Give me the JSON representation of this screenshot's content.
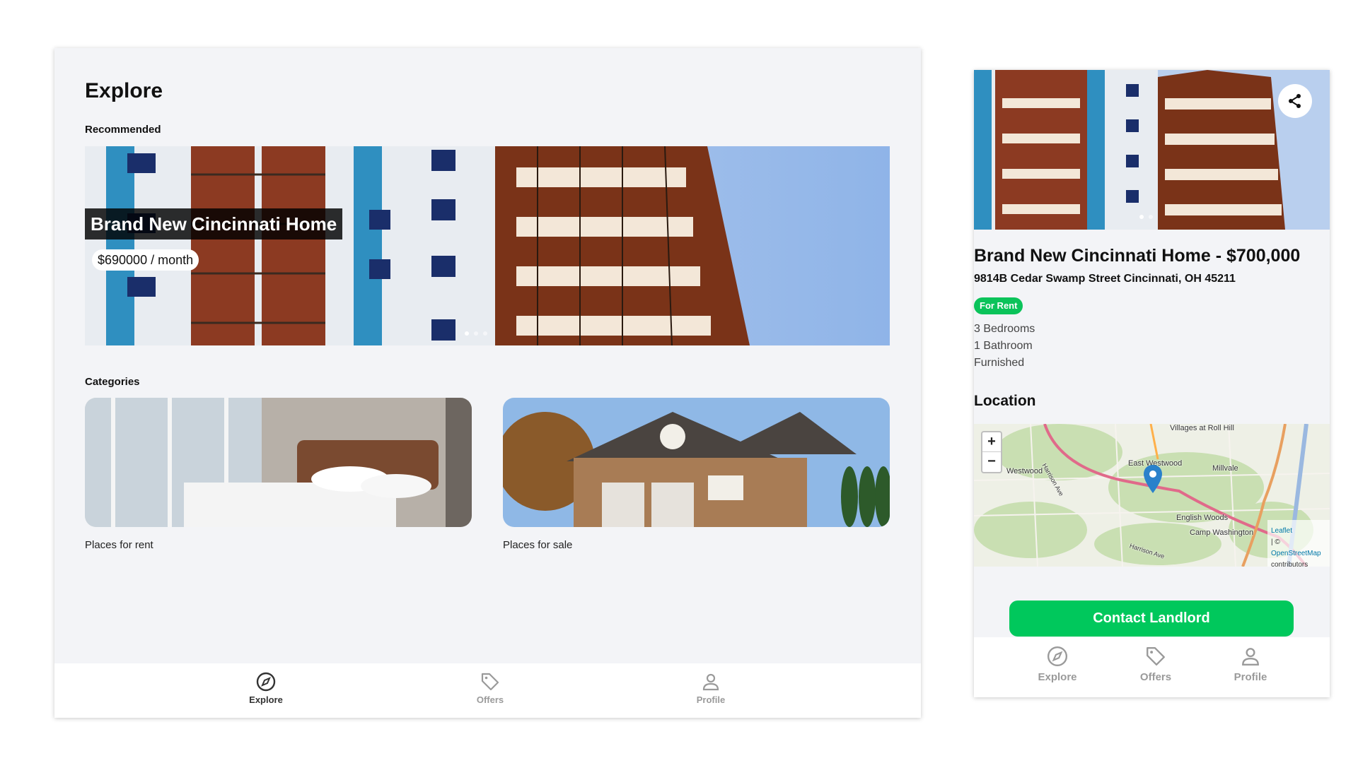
{
  "desktop": {
    "title": "Explore",
    "recommended_label": "Recommended",
    "featured": {
      "title": "Brand New Cincinnati Home",
      "price": "$690000 / month",
      "slide_count": 3,
      "active_slide": 1
    },
    "categories_label": "Categories",
    "categories": [
      {
        "label": "Places for rent"
      },
      {
        "label": "Places for sale"
      }
    ],
    "tabs": [
      {
        "label": "Explore",
        "icon": "compass-icon",
        "active": true
      },
      {
        "label": "Offers",
        "icon": "tag-icon",
        "active": false
      },
      {
        "label": "Profile",
        "icon": "user-icon",
        "active": false
      }
    ]
  },
  "mobile": {
    "gallery": {
      "slide_count": 2,
      "active_slide": 1
    },
    "title": "Brand New Cincinnati Home - $700,000",
    "address": "9814B Cedar Swamp Street Cincinnati, OH 45211",
    "status_badge": "For Rent",
    "features": [
      "3 Bedrooms",
      "1 Bathroom",
      "Furnished"
    ],
    "location_label": "Location",
    "map": {
      "zoom_in": "+",
      "zoom_out": "−",
      "places": [
        "Villages at Roll Hill",
        "Westwood",
        "East Westwood",
        "Millvale",
        "English Woods",
        "Camp Washington"
      ],
      "streets": [
        "Harrison Ave",
        "Harrison Ave"
      ],
      "attribution": {
        "leaflet": "Leaflet",
        "sep": "| ©",
        "osm": "OpenStreetMap",
        "contributors": "contributors"
      }
    },
    "contact_button": "Contact Landlord",
    "tabs": [
      {
        "label": "Explore",
        "icon": "compass-icon"
      },
      {
        "label": "Offers",
        "icon": "tag-icon"
      },
      {
        "label": "Profile",
        "icon": "user-icon"
      }
    ]
  },
  "colors": {
    "accent_green": "#00c85c",
    "badge_green": "#0bc35a",
    "panel_bg": "#f3f4f7",
    "tab_active": "#333333",
    "tab_inactive": "#9a9a9a"
  }
}
